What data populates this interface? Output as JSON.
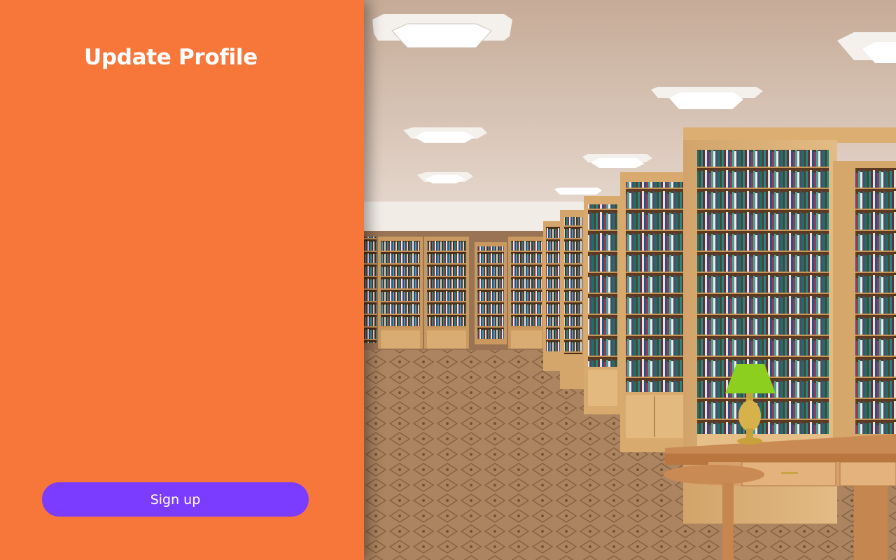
{
  "form": {
    "title": "Update Profile",
    "submit_label": "Sign up"
  },
  "colors": {
    "panel_background": "#f7763a",
    "button_background": "#7c3cff",
    "text": "#ffffff"
  },
  "hero_image": {
    "icon": "library-photo"
  }
}
